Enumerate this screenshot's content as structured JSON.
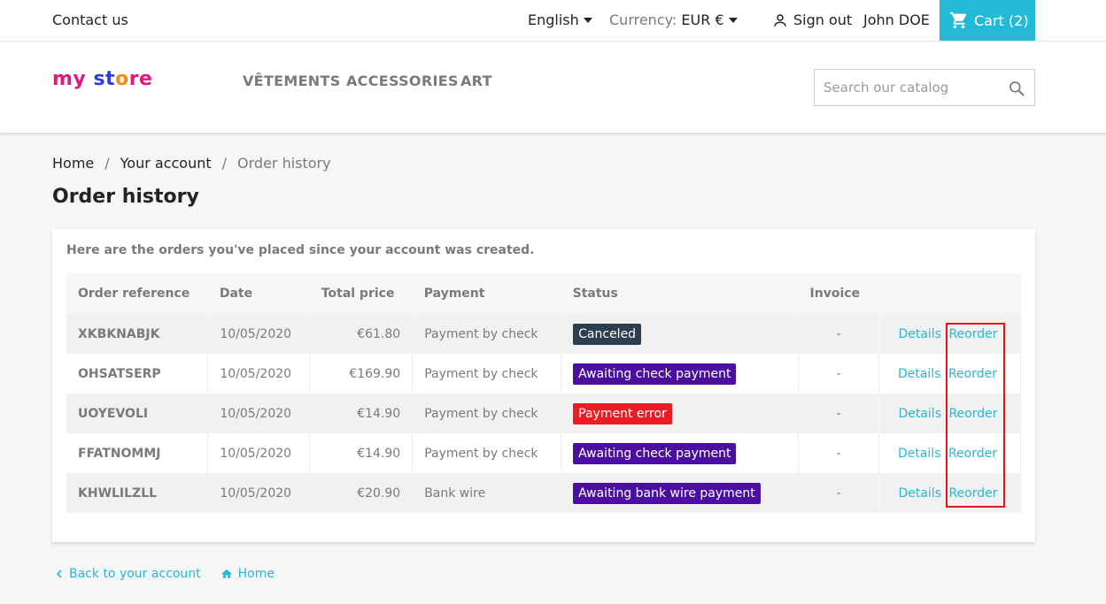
{
  "topnav": {
    "contact": "Contact us",
    "language": "English",
    "currency_label": "Currency:",
    "currency_value": "EUR €",
    "sign_out": "Sign out",
    "user_name": "John DOE",
    "cart": "Cart (2)"
  },
  "header": {
    "logo_parts": [
      "my",
      " ",
      "st",
      "o",
      "re"
    ],
    "menu": [
      "VÊTEMENTS",
      "ACCESSORIES",
      "ART"
    ],
    "search_placeholder": "Search our catalog"
  },
  "breadcrumb": {
    "items": [
      "Home",
      "Your account",
      "Order history"
    ],
    "separator": "/"
  },
  "page": {
    "title": "Order history",
    "intro": "Here are the orders you've placed since your account was created."
  },
  "table": {
    "headers": [
      "Order reference",
      "Date",
      "Total price",
      "Payment",
      "Status",
      "Invoice",
      ""
    ],
    "rows": [
      {
        "ref": "XKBKNABJK",
        "date": "10/05/2020",
        "total": "€61.80",
        "payment": "Payment by check",
        "status": "Canceled",
        "status_color": "#2c3e50",
        "invoice": "-",
        "details": "Details",
        "reorder": "Reorder"
      },
      {
        "ref": "OHSATSERP",
        "date": "10/05/2020",
        "total": "€169.90",
        "payment": "Payment by check",
        "status": "Awaiting check payment",
        "status_color": "#4b0fa0",
        "invoice": "-",
        "details": "Details",
        "reorder": "Reorder"
      },
      {
        "ref": "UOYEVOLI",
        "date": "10/05/2020",
        "total": "€14.90",
        "payment": "Payment by check",
        "status": "Payment error",
        "status_color": "#ec1c24",
        "invoice": "-",
        "details": "Details",
        "reorder": "Reorder"
      },
      {
        "ref": "FFATNOMMJ",
        "date": "10/05/2020",
        "total": "€14.90",
        "payment": "Payment by check",
        "status": "Awaiting check payment",
        "status_color": "#4b0fa0",
        "invoice": "-",
        "details": "Details",
        "reorder": "Reorder"
      },
      {
        "ref": "KHWLILZLL",
        "date": "10/05/2020",
        "total": "€20.90",
        "payment": "Bank wire",
        "status": "Awaiting bank wire payment",
        "status_color": "#4b0fa0",
        "invoice": "-",
        "details": "Details",
        "reorder": "Reorder"
      }
    ]
  },
  "footer_links": {
    "back": "Back to your account",
    "home": "Home"
  },
  "colors": {
    "accent": "#24b9d7",
    "highlight": "#e01818"
  }
}
